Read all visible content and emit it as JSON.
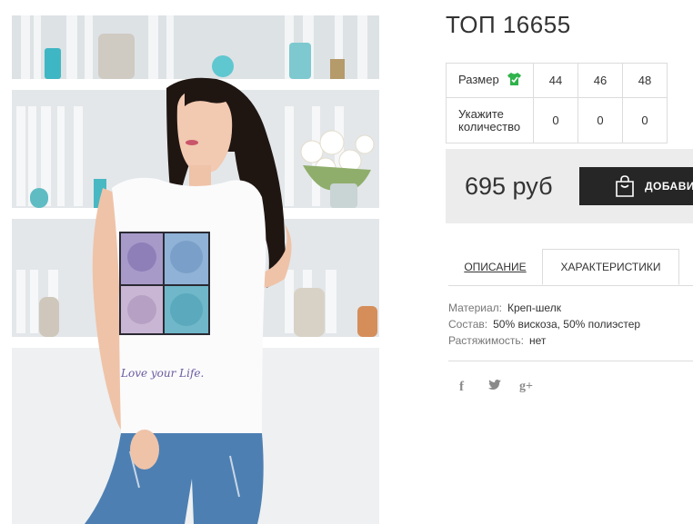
{
  "product": {
    "title": "ТОП 16655",
    "image": "product-photo",
    "price": "695 руб"
  },
  "size_table": {
    "size_label": "Размер",
    "qty_label_line1": "Укажите",
    "qty_label_line2": "количество",
    "sizes": [
      "44",
      "46",
      "48"
    ],
    "quantities": [
      "0",
      "0",
      "0"
    ]
  },
  "cart": {
    "add_label": "ДОБАВИТ",
    "icon": "shopping-bag-icon"
  },
  "tabs": [
    {
      "label": "ОПИСАНИЕ"
    },
    {
      "label": "ХАРАКТЕРИСТИКИ",
      "active": true
    }
  ],
  "specs": [
    {
      "key": "Материал:",
      "value": "Креп-шелк"
    },
    {
      "key": "Состав:",
      "value": "50% вискоза, 50% полиэстер"
    },
    {
      "key": "Растяжимость:",
      "value": "нет"
    }
  ],
  "photo_text": "Love your Life.",
  "social": {
    "facebook": "f",
    "twitter": "t",
    "googleplus": "g+"
  },
  "colors": {
    "accent_green": "#2fb34a",
    "button_dark": "#262626",
    "price_bg": "#ececec"
  }
}
